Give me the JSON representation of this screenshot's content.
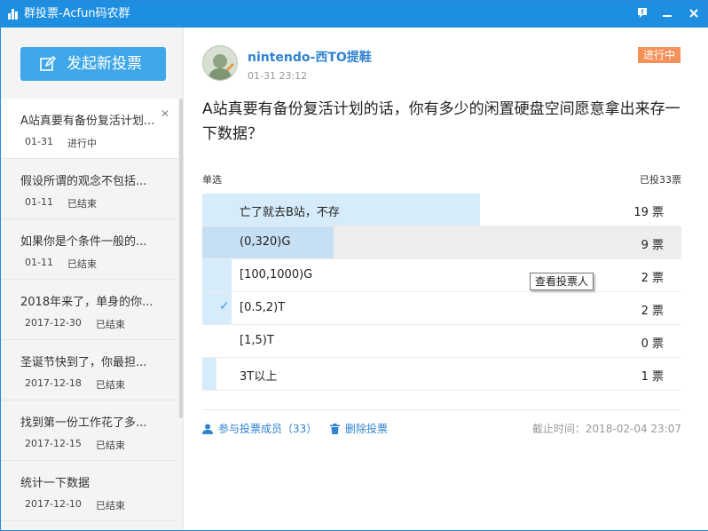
{
  "window": {
    "title": "群投票-Acfun码农群",
    "feedback_icon": "feedback-icon",
    "minimize_icon": "minimize-icon",
    "close_icon": "close-icon",
    "brand_color": "#1e8fe0"
  },
  "sidebar": {
    "new_poll_label": "发起新投票",
    "items": [
      {
        "title": "A站真要有备份复活计划...",
        "date": "01-31",
        "status": "进行中",
        "active": true
      },
      {
        "title": "假设所谓的观念不包括...",
        "date": "01-11",
        "status": "已结束"
      },
      {
        "title": "如果你是个条件一般的...",
        "date": "01-11",
        "status": "已结束"
      },
      {
        "title": "2018年来了，单身的你...",
        "date": "2017-12-30",
        "status": "已结束"
      },
      {
        "title": "圣诞节快到了，你最担...",
        "date": "2017-12-18",
        "status": "已结束"
      },
      {
        "title": "找到第一份工作花了多...",
        "date": "2017-12-15",
        "status": "已结束"
      },
      {
        "title": "统计一下数据",
        "date": "2017-12-10",
        "status": "已结束"
      }
    ]
  },
  "poll": {
    "author": "nintendo-西TO提鞋",
    "time": "01-31 23:12",
    "status_tag": "进行中",
    "status_color": "#f7915a",
    "question": "A站真要有备份复活计划的话，你有多少的闲置硬盘空间愿意拿出来存一下数据？",
    "type": "单选",
    "total": "已投33票",
    "options": [
      {
        "label": "亡了就去B站，不存",
        "votes": "19 票",
        "count": 19,
        "selected": false
      },
      {
        "label": "(0,320)G",
        "votes": "9 票",
        "count": 9,
        "selected": false,
        "hovered": true
      },
      {
        "label": "[100,1000)G",
        "votes": "2 票",
        "count": 2,
        "selected": false
      },
      {
        "label": "[0.5,2)T",
        "votes": "2 票",
        "count": 2,
        "selected": true
      },
      {
        "label": "[1,5)T",
        "votes": "0 票",
        "count": 0,
        "selected": false
      },
      {
        "label": "3T以上",
        "votes": "1 票",
        "count": 1,
        "selected": false
      }
    ],
    "tooltip": "查看投票人",
    "members_link": "参与投票成员（33）",
    "delete_link": "删除投票",
    "deadline": "截止时间：2018-02-04 23:07"
  }
}
